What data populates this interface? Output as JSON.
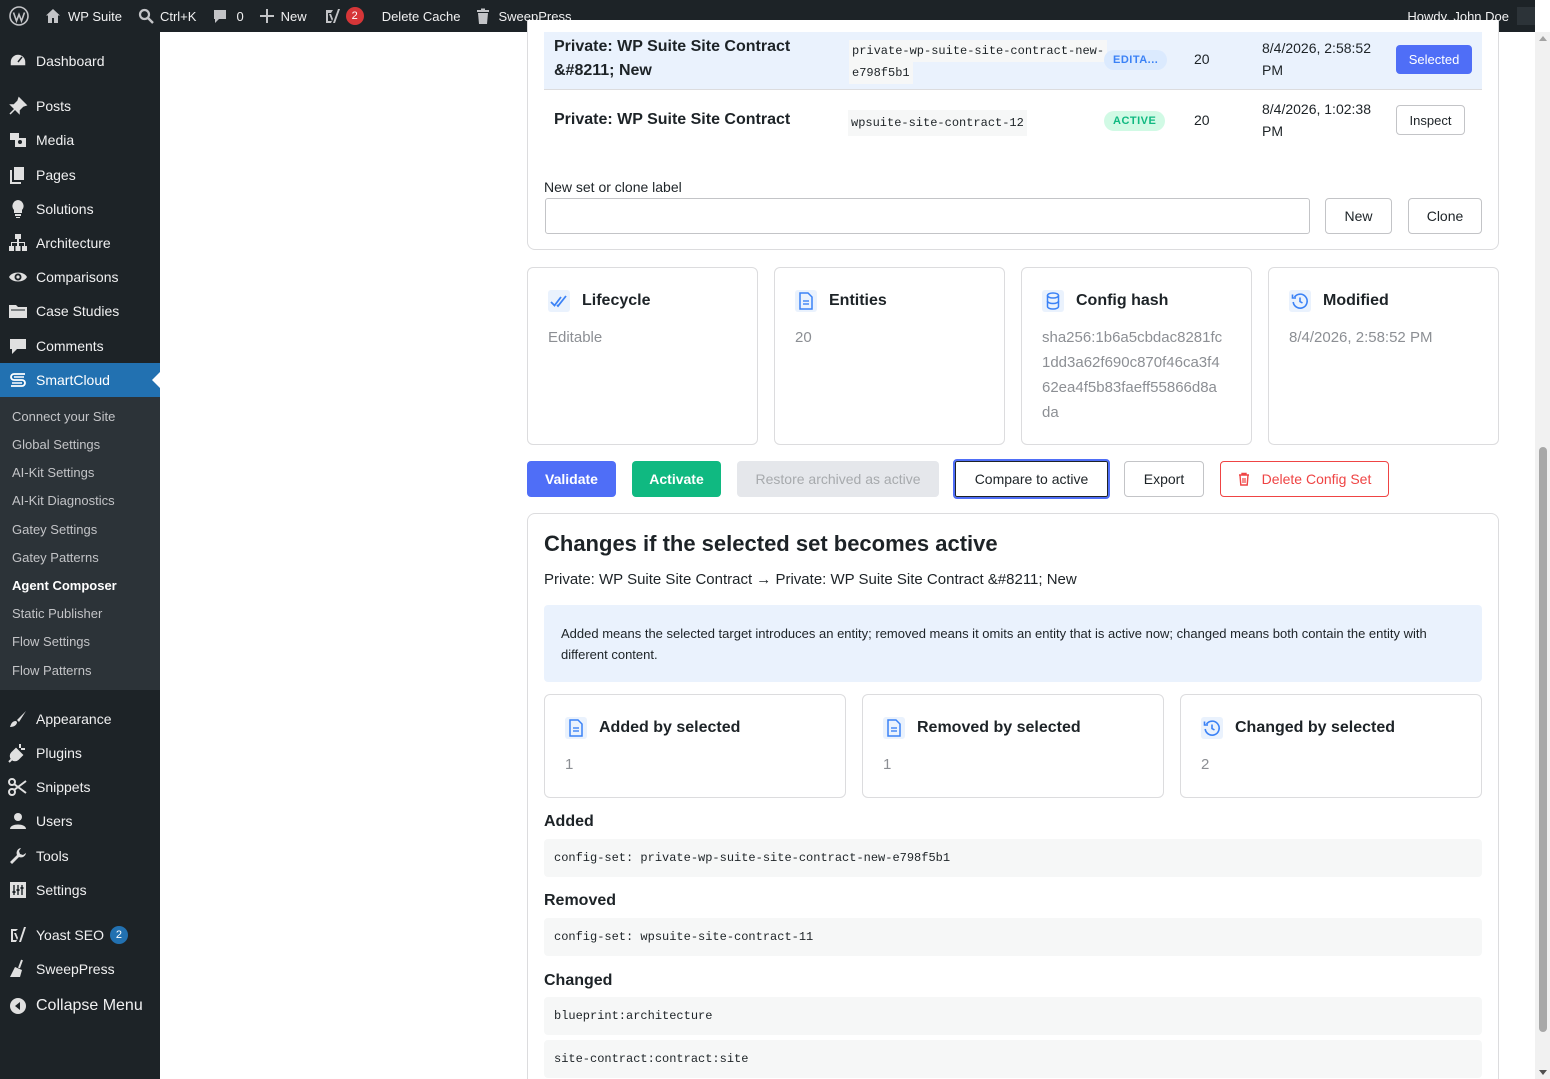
{
  "admin_bar": {
    "site_name": "WP Suite",
    "search_shortcut": "Ctrl+K",
    "comments_count": "0",
    "new_label": "New",
    "yoast_count": "2",
    "delete_cache": "Delete Cache",
    "sweeppress": "SweepPress",
    "howdy": "Howdy, John Doe"
  },
  "sidebar": {
    "items": [
      {
        "label": "Dashboard",
        "icon": "dashboard-icon"
      },
      {
        "label": "Posts",
        "icon": "pin-icon"
      },
      {
        "label": "Media",
        "icon": "media-icon"
      },
      {
        "label": "Pages",
        "icon": "pages-icon"
      },
      {
        "label": "Solutions",
        "icon": "lightbulb-icon"
      },
      {
        "label": "Architecture",
        "icon": "sitemap-icon"
      },
      {
        "label": "Comparisons",
        "icon": "eye-icon"
      },
      {
        "label": "Case Studies",
        "icon": "folder-icon"
      },
      {
        "label": "Comments",
        "icon": "comment-icon"
      },
      {
        "label": "SmartCloud",
        "icon": "smartcloud-icon"
      }
    ],
    "submenu": [
      "Connect your Site",
      "Global Settings",
      "AI-Kit Settings",
      "AI-Kit Diagnostics",
      "Gatey Settings",
      "Gatey Patterns",
      "Agent Composer",
      "Static Publisher",
      "Flow Settings",
      "Flow Patterns"
    ],
    "items2": [
      {
        "label": "Appearance",
        "icon": "brush-icon"
      },
      {
        "label": "Plugins",
        "icon": "plugin-icon"
      },
      {
        "label": "Snippets",
        "icon": "scissors-icon"
      },
      {
        "label": "Users",
        "icon": "user-icon"
      },
      {
        "label": "Tools",
        "icon": "wrench-icon"
      },
      {
        "label": "Settings",
        "icon": "settings-icon"
      },
      {
        "label": "Yoast SEO",
        "icon": "yoast-icon",
        "badge": "2"
      },
      {
        "label": "SweepPress",
        "icon": "broom-icon"
      },
      {
        "label": "Collapse Menu",
        "icon": "collapse-icon"
      }
    ]
  },
  "config_sets": {
    "rows": [
      {
        "title_line1": "Private: WP Suite Site Contract",
        "title_line2": "&#8211; New",
        "slug_line1": "private-wp-suite-site-contract-new-",
        "slug_line2": "e798f5b1",
        "status": "EDITA...",
        "entities": "20",
        "date_line1": "8/4/2026, 2:58:52",
        "date_line2": "PM",
        "action": "Selected"
      },
      {
        "title": "Private: WP Suite Site Contract",
        "slug": "wpsuite-site-contract-12",
        "status": "ACTIVE",
        "entities": "20",
        "date_line1": "8/4/2026, 1:02:38",
        "date_line2": "PM",
        "action": "Inspect"
      }
    ],
    "new_label_caption": "New set or clone label",
    "new_label_value": "",
    "new_button": "New",
    "clone_button": "Clone"
  },
  "stats": [
    {
      "title": "Lifecycle",
      "value": "Editable",
      "icon": "double-check-icon"
    },
    {
      "title": "Entities",
      "value": "20",
      "icon": "document-icon"
    },
    {
      "title": "Config hash",
      "value_lines": [
        "sha256:1b6a5cbdac8281fc",
        "1dd3a62f690c870f46ca3f4",
        "62ea4f5b83faeff55866d8a",
        "da"
      ],
      "icon": "database-icon"
    },
    {
      "title": "Modified",
      "value": "8/4/2026, 2:58:52 PM",
      "icon": "history-icon"
    }
  ],
  "actions": {
    "validate": "Validate",
    "activate": "Activate",
    "restore": "Restore archived as active",
    "compare": "Compare to active",
    "export": "Export",
    "delete": "Delete Config Set"
  },
  "changes": {
    "heading": "Changes if the selected set becomes active",
    "transition": "Private: WP Suite Site Contract → Private: WP Suite Site Contract &#8211; New",
    "notice": "Added means the selected target introduces an entity; removed means it omits an entity that is active now; changed means both contain the entity with different content.",
    "summary": [
      {
        "title": "Added by selected",
        "value": "1",
        "icon": "document-icon"
      },
      {
        "title": "Removed by selected",
        "value": "1",
        "icon": "document-icon"
      },
      {
        "title": "Changed by selected",
        "value": "2",
        "icon": "history-icon"
      }
    ],
    "added_label": "Added",
    "added": [
      "config-set: private-wp-suite-site-contract-new-e798f5b1"
    ],
    "removed_label": "Removed",
    "removed": [
      "config-set: wpsuite-site-contract-11"
    ],
    "changed_label": "Changed",
    "changed": [
      "blueprint:architecture",
      "site-contract:contract:site"
    ]
  },
  "colors": {
    "primary": "#4f6ef7",
    "success": "#10b981",
    "danger": "#ef4444",
    "admin_bg": "#1d2327",
    "wp_blue": "#2271b1"
  }
}
